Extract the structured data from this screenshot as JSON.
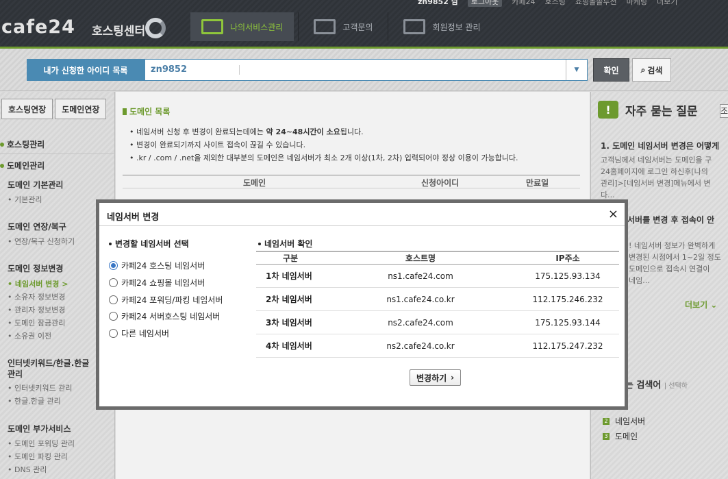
{
  "header": {
    "util_links": {
      "user": "zn9852 님",
      "logout": "로그아웃",
      "links": [
        "카페24",
        "호스팅",
        "쇼핑몰솔루션",
        "마케팅",
        "더보기"
      ]
    },
    "logo": "cafe24",
    "logo_sub": "호스팅센터",
    "gnb": [
      {
        "label": "나의서비스관리",
        "icon": "server-gear-icon"
      },
      {
        "label": "고객문의",
        "icon": "monitor-clock-icon"
      },
      {
        "label": "회원정보 관리",
        "icon": "monitor-user-icon"
      }
    ]
  },
  "search": {
    "label": "내가 신청한 아이디 목록",
    "value": "zn9852",
    "confirm": "확인",
    "search": "검색"
  },
  "sidebar": {
    "buttons": [
      "호스팅연장",
      "도메인연장"
    ],
    "categories": [
      "호스팅관리",
      "도메인관리"
    ],
    "groups": [
      {
        "title": "도메인 기본관리",
        "links": [
          "기본관리"
        ]
      },
      {
        "title": "도메인 연장/복구",
        "links": [
          "연장/복구 신청하기"
        ]
      },
      {
        "title": "도메인 정보변경",
        "links": [
          "네임서버 변경 >",
          "소유자 정보변경",
          "관리자 정보변경",
          "도메인 잠금관리",
          "소유권 이전"
        ]
      },
      {
        "title_line1": "인터넷키워드/한글.한글",
        "title_line2": "관리",
        "links": [
          "인터넷키워드 관리",
          "한글.한글 관리"
        ]
      },
      {
        "title": "도메인 부가서비스",
        "links": [
          "도메인 포워딩 관리",
          "도메인 파킹 관리",
          "DNS 관리"
        ]
      }
    ]
  },
  "main": {
    "title": "도메인 목록",
    "notices": [
      {
        "pre": "네임서버 신청 후 변경이 완료되는데에는 ",
        "strong": "약 24~48시간이 소요",
        "post": "됩니다."
      },
      {
        "pre": "변경이 완료되기까지 사이트 접속이 끊길 수 있습니다.",
        "strong": "",
        "post": ""
      },
      {
        "pre": ".kr / .com / .net을 제외한 대부분의 도메인은 네임서버가 최소 2개 이상(1차, 2차) 입력되어야 정상 이용이 가능합니다.",
        "strong": "",
        "post": ""
      }
    ],
    "table_headers": [
      "도메인",
      "신청아이디",
      "만료일"
    ]
  },
  "right": {
    "faq_title": "자주 묻는 질문",
    "faq_tab": "조",
    "faq": [
      {
        "q": "1. 도메인 네임서버 변경은 어떻게",
        "a": [
          "고객님께서 네임서버는 도메인을 구",
          "24홈페이지에 로그인 하신후[나의",
          "관리]>[네임서버 변경]메뉴에서 변",
          "다..."
        ]
      },
      {
        "q": "서버를 변경 후 접속이 안",
        "a": [
          "! 네임서버 정보가 완벽하게",
          "변경된 시점에서 1~2일 정도",
          "도메인으로 접속시 연결이",
          "네임..."
        ]
      }
    ],
    "more": "더보기",
    "keyword_title": "조회되는 검색어",
    "keyword_sub": "선택하",
    "keyword_s": "S",
    "keywords": [
      {
        "num": "2",
        "label": "네임서버"
      },
      {
        "num": "3",
        "label": "도메인"
      }
    ]
  },
  "modal": {
    "title": "네임서버 변경",
    "close": "×",
    "left_title": "변경할 네임서버 선택",
    "options": [
      {
        "label": "카페24 호스팅 네임서버",
        "checked": true
      },
      {
        "label": "카페24 쇼핑몰 네임서버",
        "checked": false
      },
      {
        "label": "카페24 포워딩/파킹 네임서버",
        "checked": false
      },
      {
        "label": "카페24 서버호스팅 네임서버",
        "checked": false
      },
      {
        "label": "다른 네임서버",
        "checked": false
      }
    ],
    "right_title": "네임서버 확인",
    "table_headers": [
      "구분",
      "호스트명",
      "IP주소"
    ],
    "rows": [
      {
        "type": "1차 네임서버",
        "host": "ns1.cafe24.com",
        "ip": "175.125.93.134"
      },
      {
        "type": "2차 네임서버",
        "host": "ns1.cafe24.co.kr",
        "ip": "112.175.246.232"
      },
      {
        "type": "3차 네임서버",
        "host": "ns2.cafe24.com",
        "ip": "175.125.93.144"
      },
      {
        "type": "4차 네임서버",
        "host": "ns2.cafe24.co.kr",
        "ip": "112.175.247.232"
      }
    ],
    "submit": "변경하기",
    "submit_arrow": "›"
  }
}
